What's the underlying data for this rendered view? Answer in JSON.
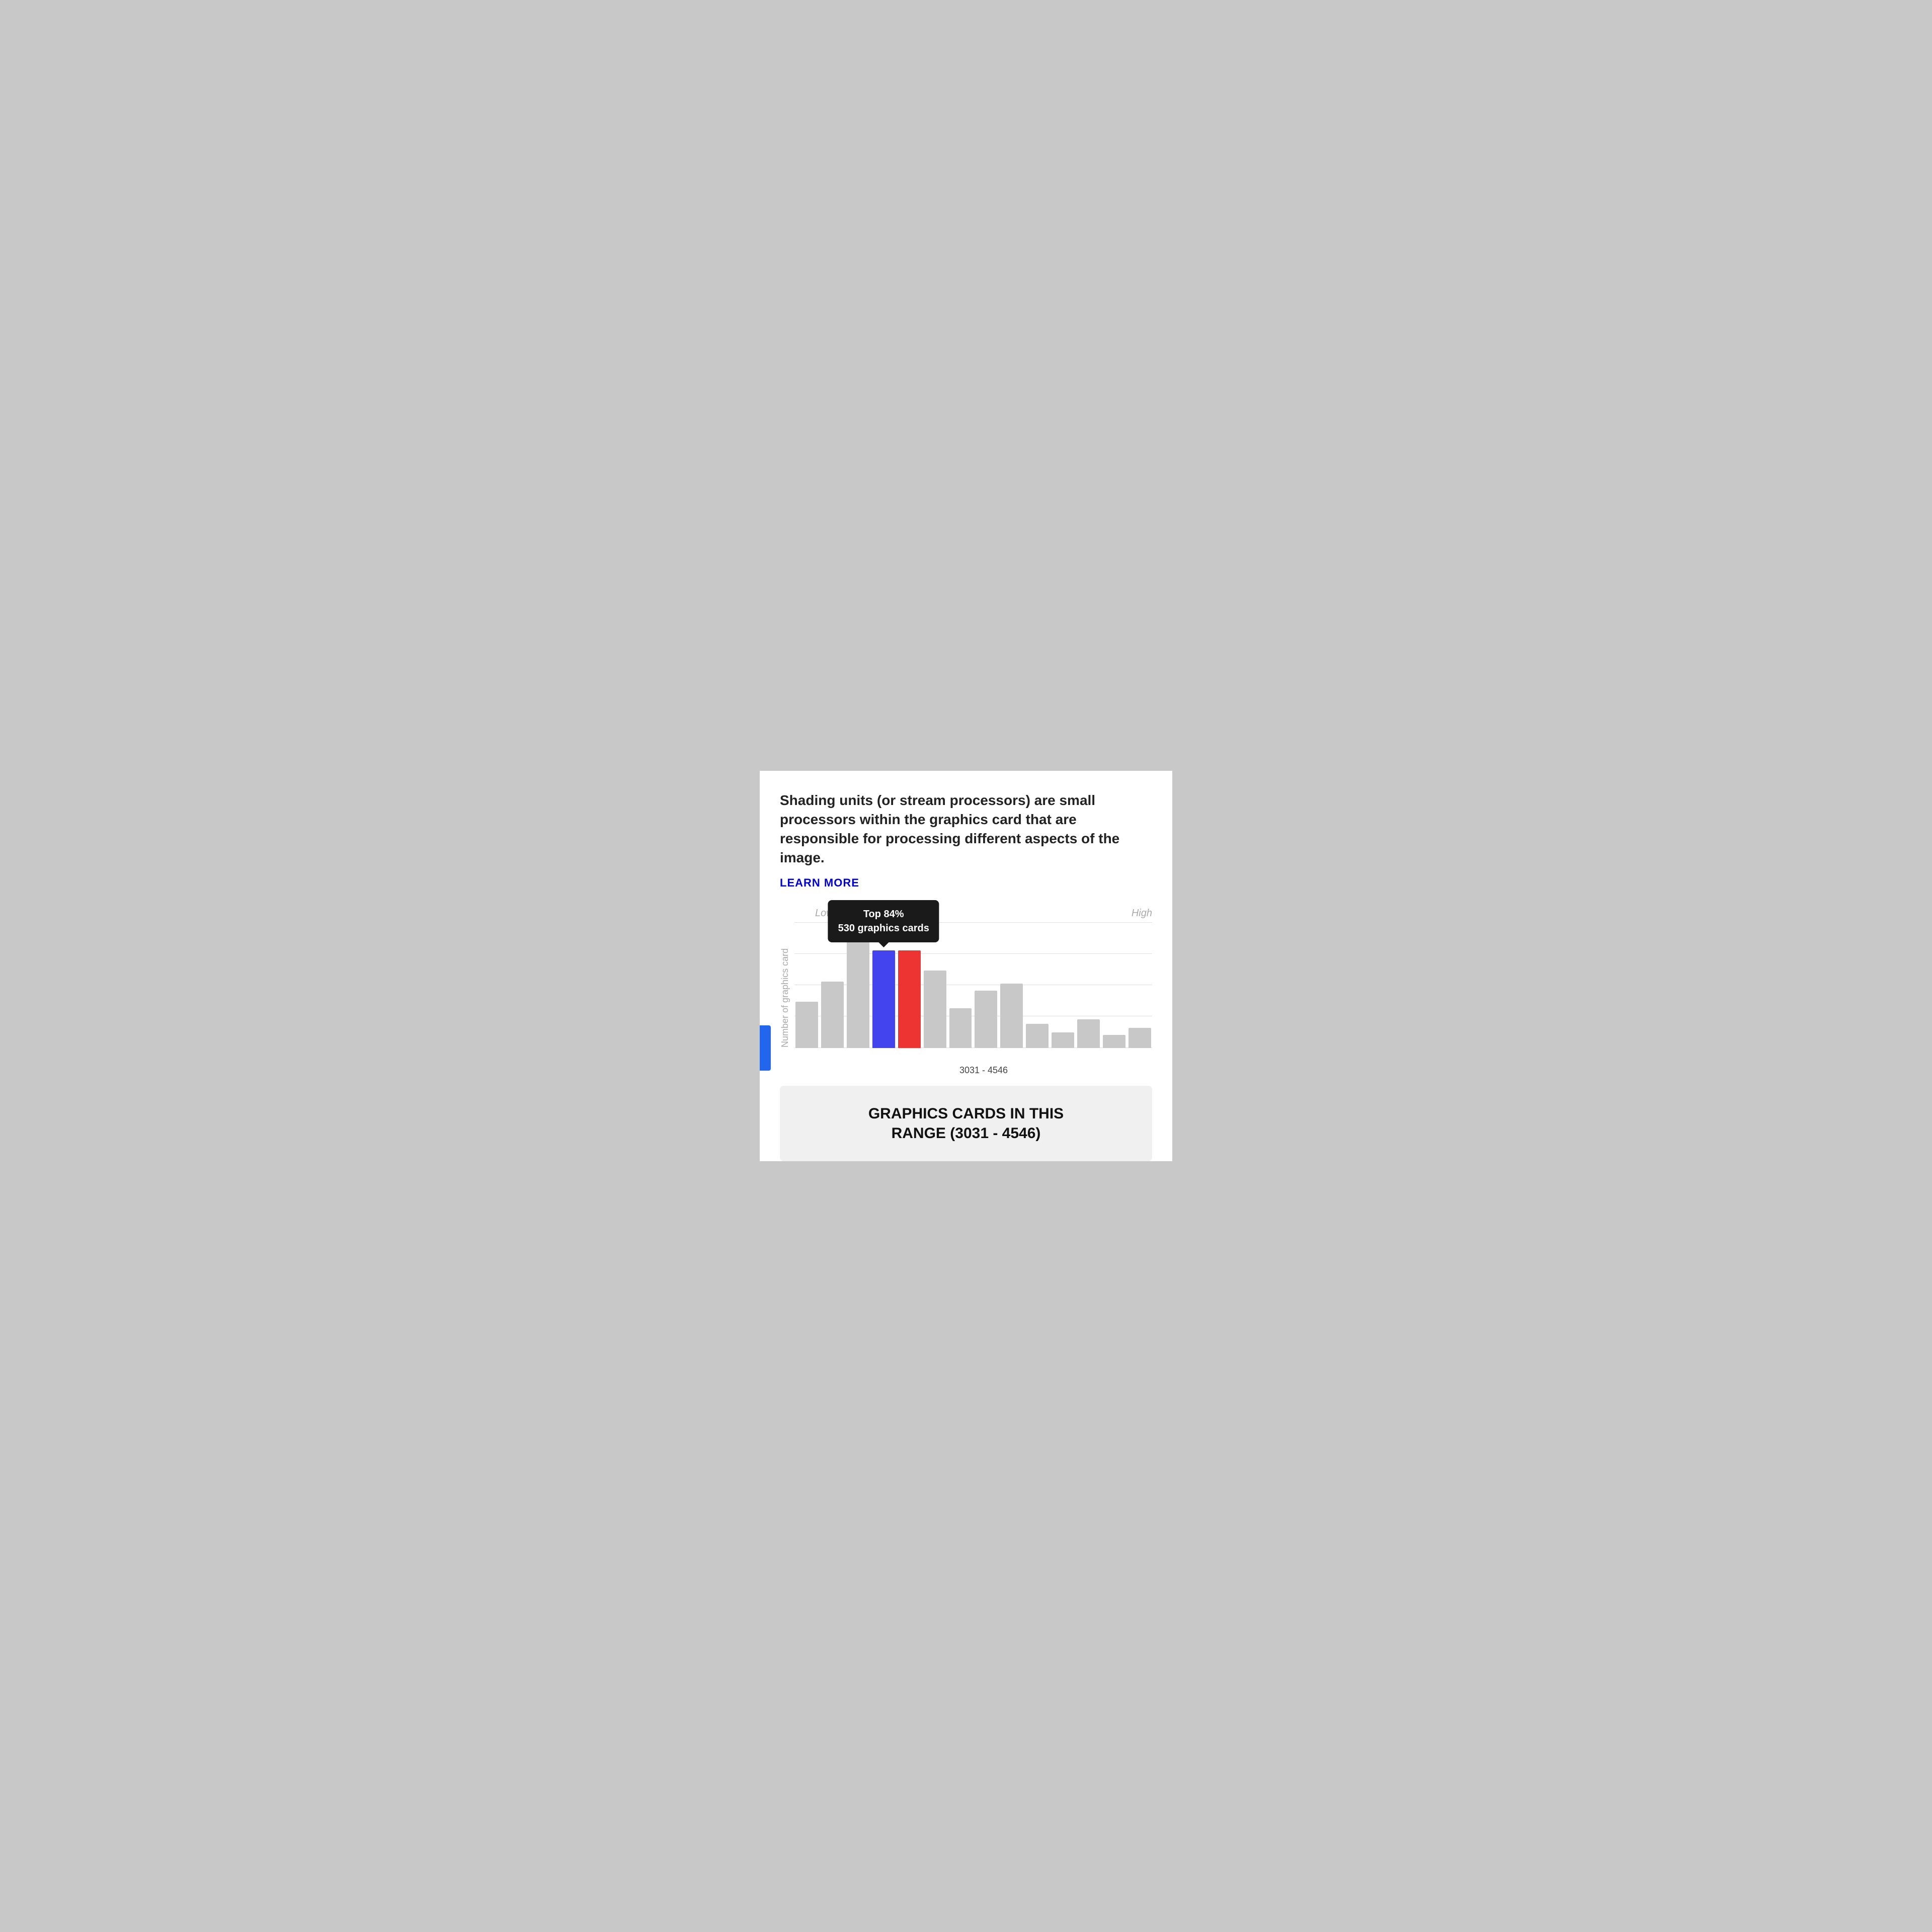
{
  "description": "Shading units (or stream processors) are small processors within the graphics card that are responsible for processing different aspects of the image.",
  "learn_more_label": "LEARN MORE",
  "axis": {
    "x_low": "Low",
    "x_high": "High",
    "y_label": "Number of graphics card"
  },
  "tooltip": {
    "line1": "Top 84%",
    "line2": "530 graphics cards"
  },
  "x_range_label": "3031 - 4546",
  "bars": [
    {
      "height_pct": 42,
      "type": "normal"
    },
    {
      "height_pct": 60,
      "type": "normal"
    },
    {
      "height_pct": 100,
      "type": "normal"
    },
    {
      "height_pct": 88,
      "type": "blue"
    },
    {
      "height_pct": 88,
      "type": "red"
    },
    {
      "height_pct": 70,
      "type": "normal"
    },
    {
      "height_pct": 36,
      "type": "normal"
    },
    {
      "height_pct": 52,
      "type": "normal"
    },
    {
      "height_pct": 58,
      "type": "normal"
    },
    {
      "height_pct": 22,
      "type": "normal"
    },
    {
      "height_pct": 14,
      "type": "normal"
    },
    {
      "height_pct": 26,
      "type": "normal"
    },
    {
      "height_pct": 12,
      "type": "normal"
    },
    {
      "height_pct": 18,
      "type": "normal"
    }
  ],
  "bottom_card": {
    "title_line1": "GRAPHICS CARDS IN THIS",
    "title_line2": "RANGE (3031 - 4546)"
  }
}
